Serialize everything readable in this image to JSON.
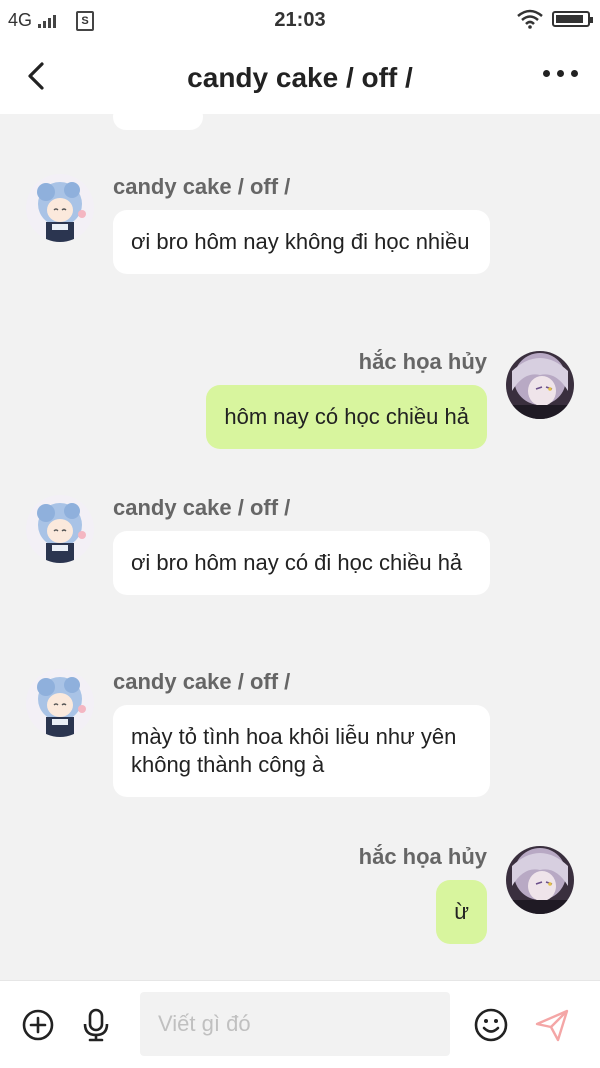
{
  "status_bar": {
    "network": "4G",
    "sim_label": "S",
    "time": "21:03",
    "battery_level": 0.9
  },
  "header": {
    "title": "candy cake / off /"
  },
  "messages": [
    {
      "side": "left",
      "sender": "candy cake / off /",
      "text": "ơi bro hôm nay không đi học nhiều"
    },
    {
      "side": "right",
      "sender": "hắc họa hủy",
      "text": "hôm nay có học chiều hả"
    },
    {
      "side": "left",
      "sender": "candy cake / off /",
      "text": "ơi bro hôm nay có đi học chiều hả"
    },
    {
      "side": "left",
      "sender": "candy cake / off /",
      "text": "mày tỏ tình hoa khôi liễu như yên không thành công à"
    },
    {
      "side": "right",
      "sender": "hắc họa hủy",
      "text": "ừ"
    }
  ],
  "input": {
    "placeholder": "Viết gì đó",
    "value": ""
  },
  "icons": {
    "back": "chevron-left-icon",
    "more": "more-horizontal-icon",
    "add": "plus-circle-icon",
    "voice": "microphone-icon",
    "emoji": "smiley-icon",
    "send": "paper-plane-icon"
  },
  "colors": {
    "own_bubble": "#d8f59e",
    "other_bubble": "#ffffff",
    "background": "#f2f2f2",
    "send_accent": "#f4a6a6"
  }
}
